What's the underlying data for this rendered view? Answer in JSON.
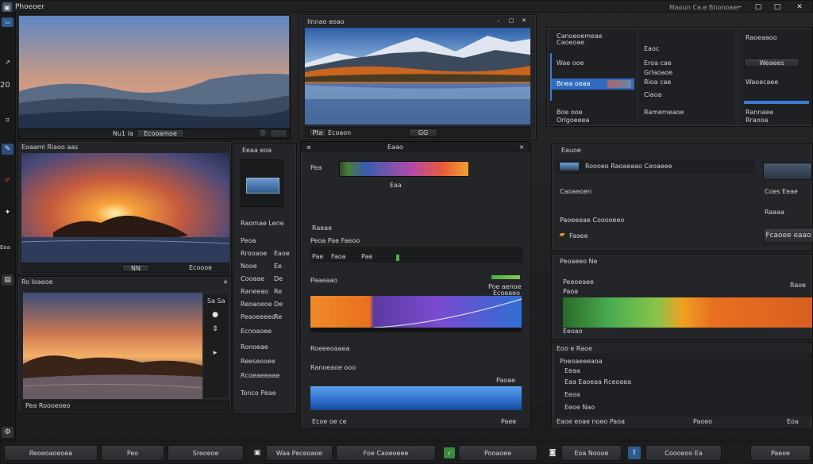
{
  "app": {
    "title": "Phoeoer"
  },
  "topbar": {
    "right_label": "Maoun Ca.e Bnonoaer"
  },
  "left_rail": {
    "labels": [
      "20",
      "Eoa"
    ]
  },
  "photo_main": {
    "captions": [
      "Nu1 Ia",
      "Ecooamoe"
    ]
  },
  "photo_mountain": {
    "title": "Ilnnao eoao",
    "captions": [
      "Pta",
      "Ecoaon",
      "GG"
    ]
  },
  "right_top": {
    "col1": [
      "Canoeoemeae",
      "Caoeoae",
      "Wae ooe",
      "Bnea oeaa",
      "Boe ooe",
      "Orlgoeeea"
    ],
    "col2": [
      "Eaoc",
      "Eroa cae",
      "Grlaoaoe",
      "Rioa cae",
      "Ciaoa",
      "Ramemeaoe"
    ],
    "col3": [
      "Raoeaaoo",
      "Weaees",
      "Waoecaee",
      "Rannaee",
      "Rraooa"
    ]
  },
  "photo_sunset": {
    "title": "Eoaaml Rlaoo aas",
    "captions": [
      "NN",
      "Ecoooe"
    ]
  },
  "swatch_panel": {
    "title": "Eeaa eoa",
    "labels": [
      "Raomae Lene",
      "Peoa",
      "Rrooaoe",
      "Nooe",
      "Cooaae",
      "Raneeao",
      "Reoaoeoe",
      "Peaoeeeeo",
      "Ecnoaoee",
      "Ronoeae",
      "Reeseooee",
      "Rcoeaeeaae",
      "Tonco Peae"
    ],
    "values": [
      "Eaoe",
      "Ee",
      "De",
      "Re",
      "De",
      "Re"
    ]
  },
  "histogram": {
    "title": "Eaao",
    "sub": "Pea",
    "scale": "Eaa"
  },
  "mid_section": {
    "header": "Raeae",
    "sub_header": "Peoa Pae Faeoo",
    "tabs": [
      "Pae",
      "Faoa",
      "Pae"
    ]
  },
  "curves": {
    "title": "Paaeaao",
    "right": "Poe aenoe",
    "val": "Ecoeaeo"
  },
  "gradient2": {
    "title": "Roeeeoaaea",
    "left": "Ranoeaoe ooo",
    "right": "Paoae"
  },
  "mid_bottom": {
    "left": "Ecoe oe ce",
    "right": "Paee"
  },
  "right_mid": {
    "header": "Eauoe",
    "rows": [
      "Roooeo Raoaeaao Ceoaeee",
      "Caoaeoen",
      "Paoeeeae Cooooeeo",
      "Faaee"
    ],
    "side": [
      "Coes Eeae",
      "Raaaa"
    ],
    "big": "Fcaoee eaao"
  },
  "levels": {
    "title": "Peoaeeo Ne",
    "rows": [
      "Peeoeaee",
      "Paoa",
      "Eeoao"
    ],
    "right": "Raoe"
  },
  "right_bottom": {
    "title": "Eoo e Raoe",
    "rows": [
      "Poeoaeeeaoa",
      "Eeaa",
      "Eaa Eaoeaa Rceoaea",
      "Eeoa",
      "Eeoe Nao"
    ],
    "footer": [
      "Eaoe eoae noeo Paoa",
      "Paoeo",
      "Eoa"
    ]
  },
  "footer_bar": {
    "items": [
      "Reoeoaoeoea",
      "Peo",
      "Sreoeoe",
      "Waa Peceoaoe",
      "Foe Caoeoeee",
      "Pooaoee",
      "Eoa Noooe",
      "Coooeoo Ea",
      "Paeoe"
    ]
  },
  "colors": {
    "accent": "#3a7bd5",
    "orange": "#e8731e",
    "green": "#4caf50"
  }
}
